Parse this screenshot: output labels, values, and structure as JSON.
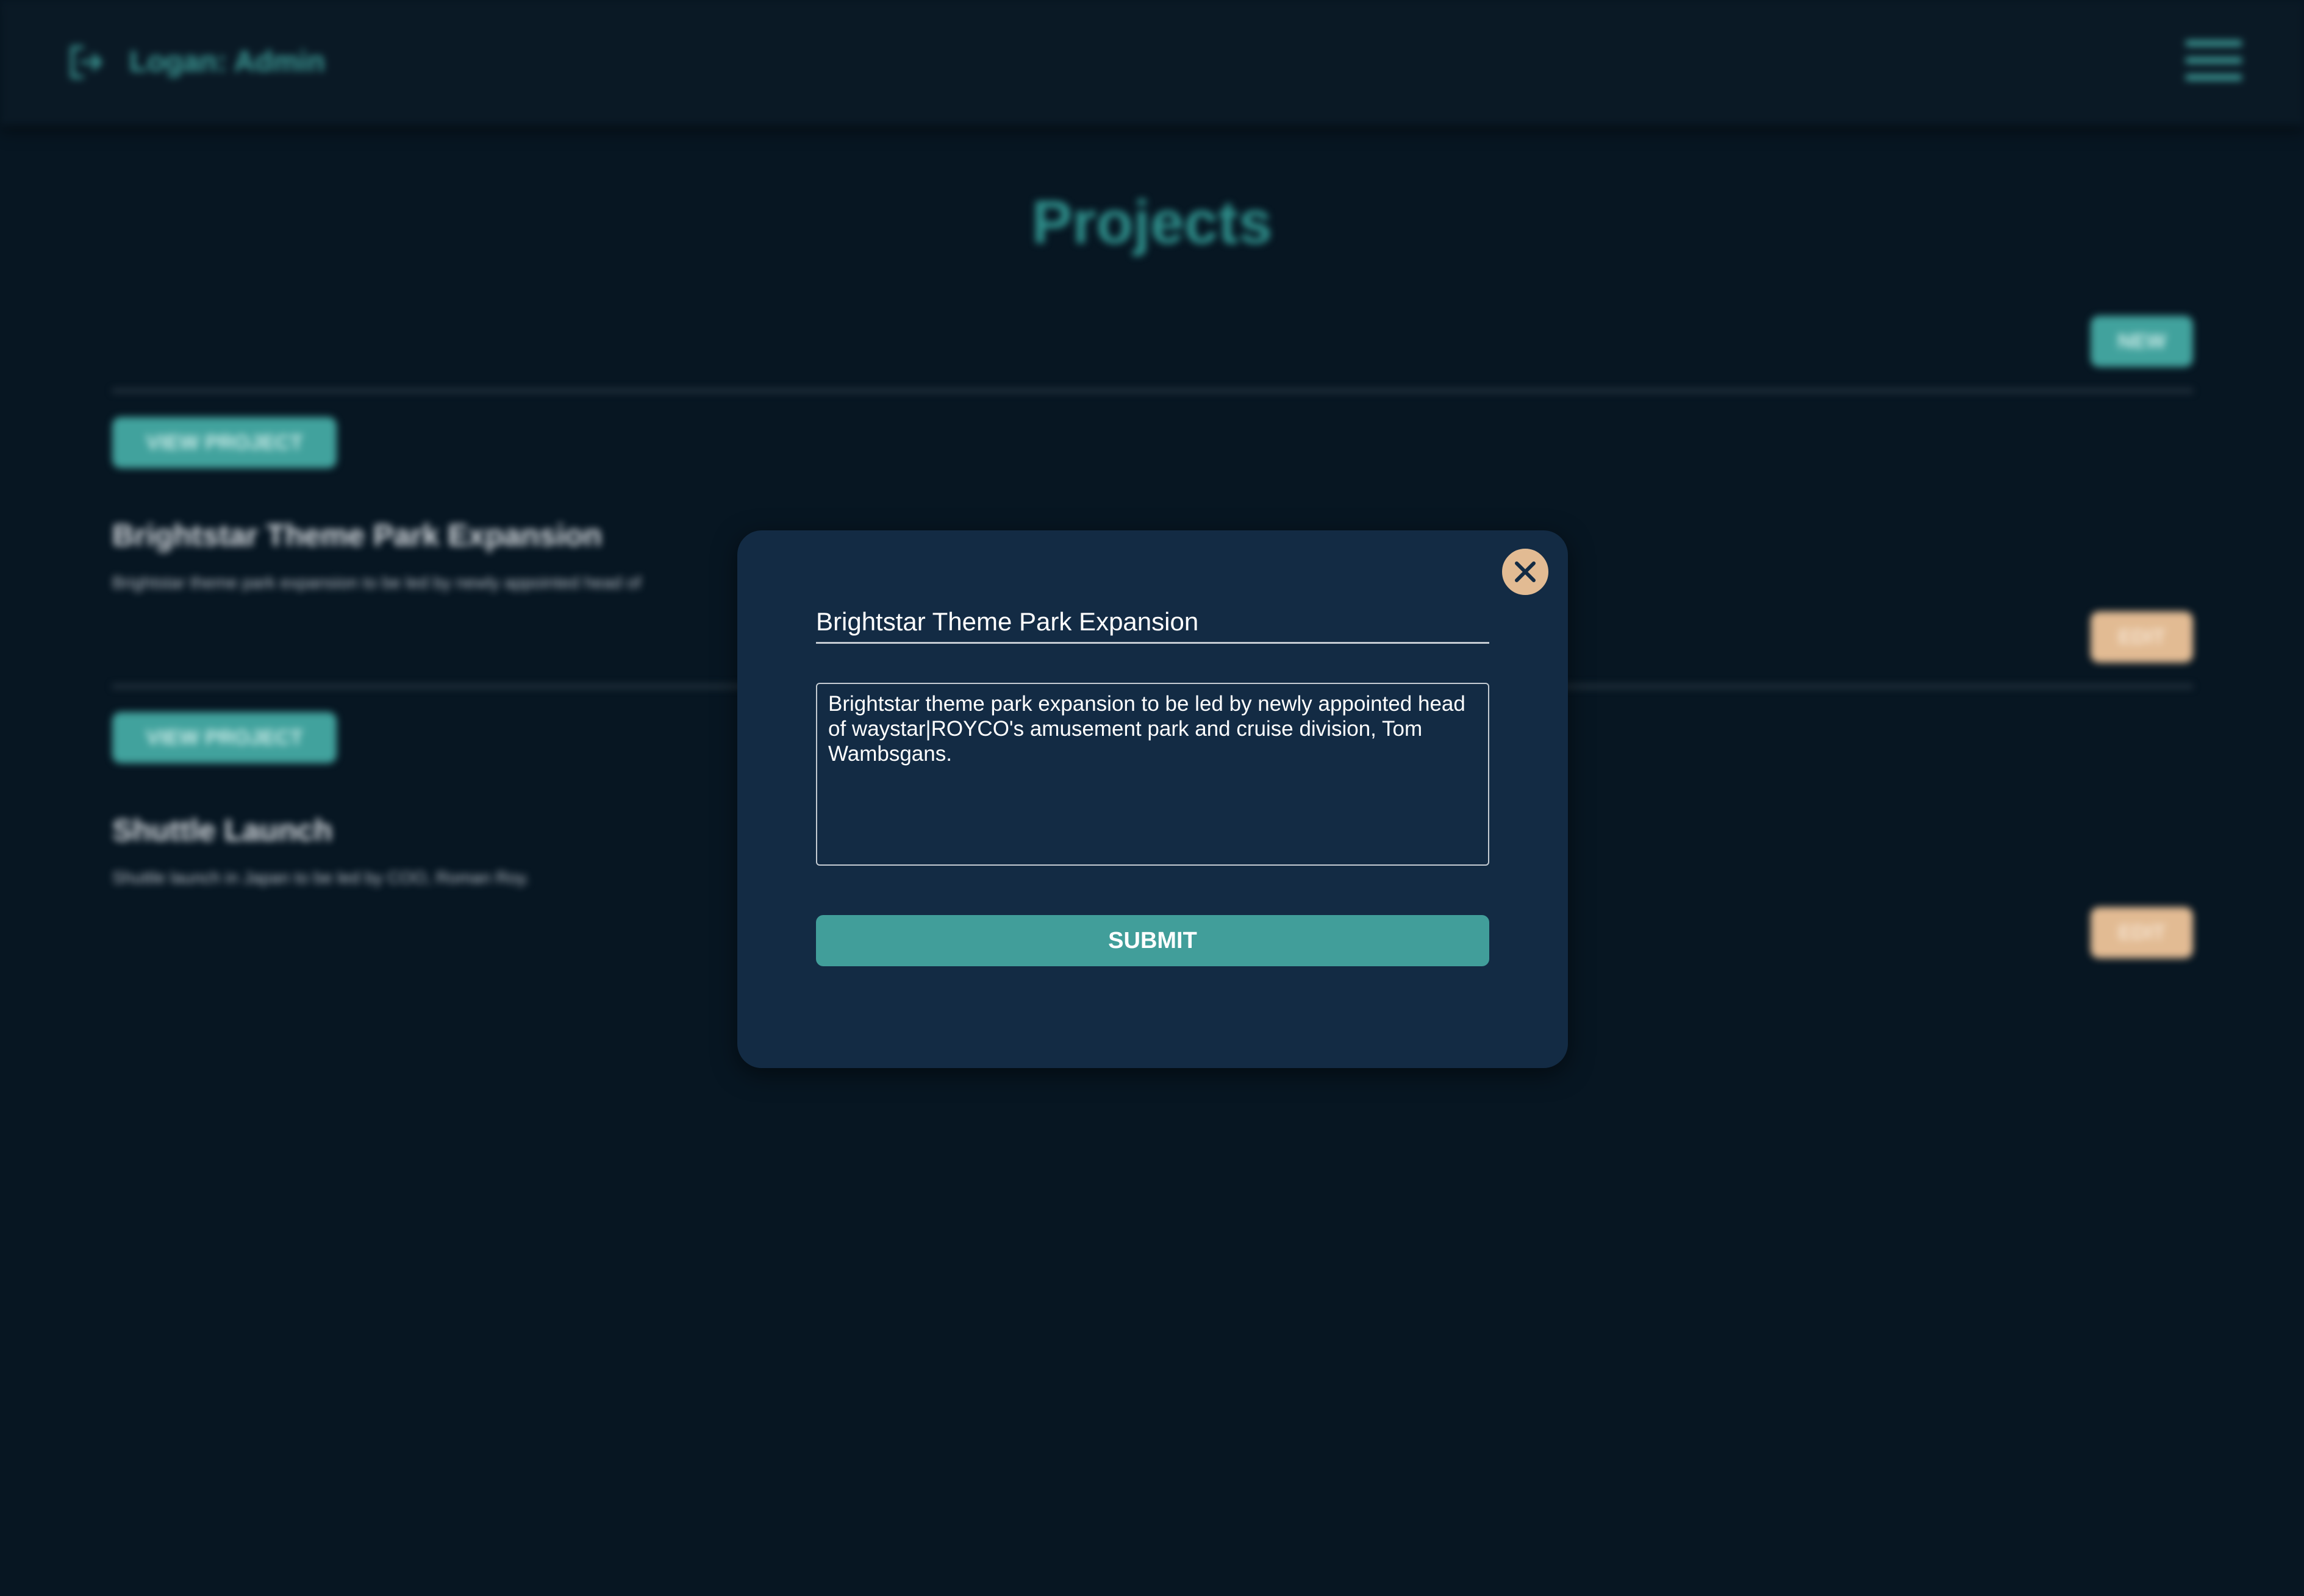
{
  "header": {
    "user_label": "Logan: Admin",
    "logout_icon": "logout-icon",
    "menu_icon": "hamburger-menu-icon"
  },
  "page": {
    "title": "Projects",
    "new_button_label": "NEW"
  },
  "projects": [
    {
      "view_label": "VIEW PROJECT",
      "title": "Brightstar Theme Park Expansion",
      "description": "Brightstar theme park expansion to be led by newly appointed head of",
      "edit_label": "EDIT"
    },
    {
      "view_label": "VIEW PROJECT",
      "title": "Shuttle Launch",
      "description": "Shuttle launch in Japan to be led by COO, Roman Roy.",
      "edit_label": "EDIT"
    }
  ],
  "modal": {
    "title_value": "Brightstar Theme Park Expansion",
    "description_value": "Brightstar theme park expansion to be led by newly appointed head of waystar|ROYCO's amusement park and cruise division, Tom Wambsgans.",
    "submit_label": "SUBMIT",
    "close_icon": "close-icon"
  },
  "colors": {
    "background": "#071622",
    "accent_teal": "#41a29d",
    "accent_tan": "#e2bb93",
    "modal_bg": "#132b44"
  }
}
